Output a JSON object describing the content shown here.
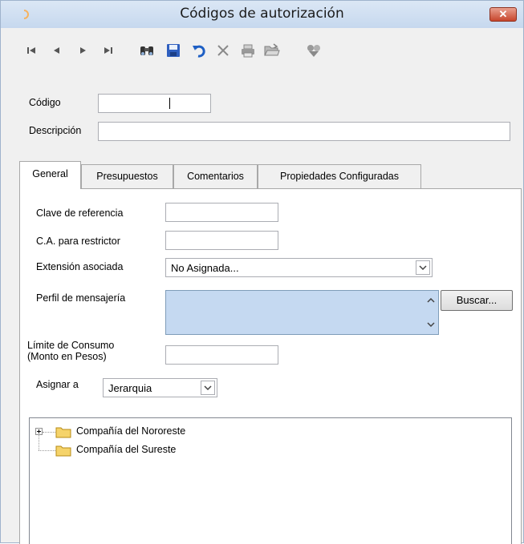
{
  "window": {
    "title": "Códigos de autorización",
    "close_label": "✕"
  },
  "toolbar": {
    "buttons": [
      "first-record",
      "previous-record",
      "next-record",
      "last-record",
      "find",
      "save",
      "undo",
      "delete",
      "print",
      "open-folder",
      "tools"
    ]
  },
  "form": {
    "codigo_label": "Código",
    "codigo_value": "",
    "descripcion_label": "Descripción",
    "descripcion_value": ""
  },
  "tabs": [
    {
      "label": "General",
      "active": true
    },
    {
      "label": "Presupuestos",
      "active": false
    },
    {
      "label": "Comentarios",
      "active": false
    },
    {
      "label": "Propiedades Configuradas",
      "active": false
    }
  ],
  "general": {
    "clave_label": "Clave de referencia",
    "clave_value": "",
    "ca_label": "C.A. para restrictor",
    "ca_value": "",
    "extension_label": "Extensión asociada",
    "extension_value": "No Asignada...",
    "perfil_label": "Perfil de mensajería",
    "buscar_label": "Buscar...",
    "limite_label_1": "Límite de Consumo",
    "limite_label_2": "(Monto en Pesos)",
    "limite_value": "",
    "asignar_label": "Asignar a",
    "asignar_value": "Jerarquia"
  },
  "tree": {
    "nodes": [
      {
        "label": "Compañía del Nororeste",
        "expandable": true
      },
      {
        "label": "Compañía del Sureste",
        "expandable": false
      }
    ]
  },
  "colors": {
    "titlebar": "#c6d8ee",
    "close_button": "#c7462c",
    "listbox_fill": "#c5d9f1",
    "folder": "#f5d36a"
  }
}
